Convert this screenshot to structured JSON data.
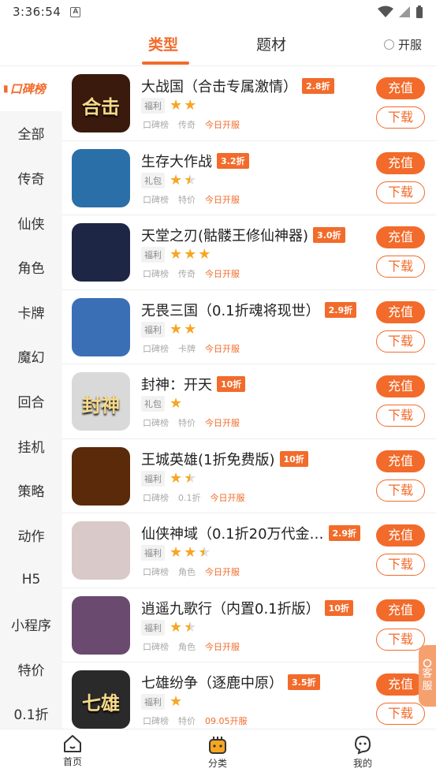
{
  "status_bar": {
    "time": "3:36:54",
    "notif_letter": "A"
  },
  "top_tabs": [
    {
      "label": "类型",
      "active": true
    },
    {
      "label": "题材",
      "active": false
    }
  ],
  "kaifu_label": "开服",
  "sidebar": [
    {
      "label": "口碑榜",
      "active": true
    },
    {
      "label": "全部"
    },
    {
      "label": "传奇"
    },
    {
      "label": "仙侠"
    },
    {
      "label": "角色"
    },
    {
      "label": "卡牌"
    },
    {
      "label": "魔幻"
    },
    {
      "label": "回合"
    },
    {
      "label": "挂机"
    },
    {
      "label": "策略"
    },
    {
      "label": "动作"
    },
    {
      "label": "H5"
    },
    {
      "label": "小程序"
    },
    {
      "label": "特价"
    },
    {
      "label": "0.1折"
    }
  ],
  "buttons": {
    "pay": "充值",
    "download": "下载"
  },
  "games": [
    {
      "title": "大战国（合击专属激情）",
      "discount": "2.8折",
      "tag": "福利",
      "stars": 2,
      "half": false,
      "rank": "口碑榜",
      "genre": "传奇",
      "open": "今日开服",
      "thumb_text": "合击",
      "thumb_bg": "#3a1a0c"
    },
    {
      "title": "生存大作战",
      "discount": "3.2折",
      "tag": "礼包",
      "stars": 1,
      "half": true,
      "rank": "口碑榜",
      "genre": "特价",
      "open": "今日开服",
      "thumb_text": "",
      "thumb_bg": "#2b6fa8"
    },
    {
      "title": "天堂之刃(骷髅王修仙神器)",
      "discount": "3.0折",
      "tag": "福利",
      "stars": 3,
      "half": false,
      "rank": "口碑榜",
      "genre": "传奇",
      "open": "今日开服",
      "thumb_text": "",
      "thumb_bg": "#1e2646"
    },
    {
      "title": "无畏三国（0.1折魂将现世）",
      "discount": "2.9折",
      "tag": "福利",
      "stars": 2,
      "half": false,
      "rank": "口碑榜",
      "genre": "卡牌",
      "open": "今日开服",
      "thumb_text": "",
      "thumb_bg": "#3b6fb5"
    },
    {
      "title": "封神：开天",
      "discount": "10折",
      "tag": "礼包",
      "stars": 1,
      "half": false,
      "rank": "口碑榜",
      "genre": "特价",
      "open": "今日开服",
      "thumb_text": "封神",
      "thumb_bg": "#d9d9d9"
    },
    {
      "title": "王城英雄(1折免费版)",
      "discount": "10折",
      "tag": "福利",
      "stars": 1,
      "half": true,
      "rank": "口碑榜",
      "genre": "0.1折",
      "open": "今日开服",
      "thumb_text": "",
      "thumb_bg": "#5a2a0a"
    },
    {
      "title": "仙侠神域（0.1折20万代金…",
      "discount": "2.9折",
      "tag": "福利",
      "stars": 2,
      "half": true,
      "rank": "口碑榜",
      "genre": "角色",
      "open": "今日开服",
      "thumb_text": "",
      "thumb_bg": "#d9c9c9"
    },
    {
      "title": "逍遥九歌行（内置0.1折版）",
      "discount": "10折",
      "tag": "福利",
      "stars": 1,
      "half": true,
      "rank": "口碑榜",
      "genre": "角色",
      "open": "今日开服",
      "thumb_text": "",
      "thumb_bg": "#6a4b6f"
    },
    {
      "title": "七雄纷争（逐鹿中原）",
      "discount": "3.5折",
      "tag": "福利",
      "stars": 1,
      "half": false,
      "rank": "口碑榜",
      "genre": "特价",
      "open": "09.05开服",
      "thumb_text": "七雄",
      "thumb_bg": "#2a2a2a"
    }
  ],
  "kefu": [
    "客",
    "服"
  ],
  "bottom_nav": [
    {
      "label": "首页",
      "icon": "home-icon"
    },
    {
      "label": "分类",
      "icon": "category-icon"
    },
    {
      "label": "我的",
      "icon": "profile-icon"
    }
  ],
  "colors": {
    "accent": "#f26b2b",
    "star": "#f6a623"
  }
}
